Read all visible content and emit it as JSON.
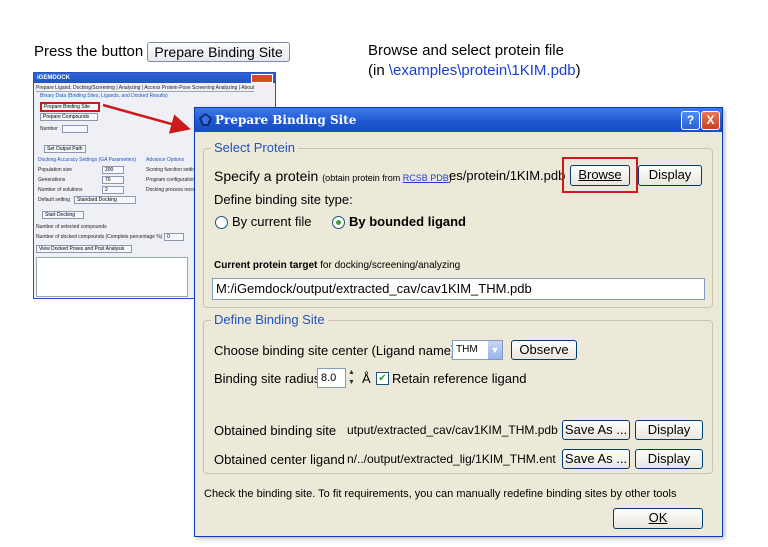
{
  "captions": {
    "press_prefix": "Press the button",
    "press_button": "Prepare Binding Site",
    "browse_line1": "Browse and select protein file",
    "browse_line2_prefix": "(in ",
    "browse_path": "\\examples\\protein\\1KIM.pdb",
    "browse_line2_suffix": ")"
  },
  "thumbnail": {
    "title": "iGEMDOCK",
    "tabs": "Prepare Ligand, Docking/Screening  | Analyzing | Access Protein-Pose Screening Analyzing | About",
    "group_caption": "Binary Data (Binding Sites, Ligands, and Docked Results)",
    "prepare_binding_site": "Prepare Binding Site",
    "prepare_compounds": "Prepare Compounds",
    "number_label": "Number",
    "set_output_path": "Set Output Path",
    "ga_caption": "Docking Accuracy Settings (GA Parameters)",
    "advanced_caption": "Advance Options",
    "rows": [
      {
        "label": "Population size",
        "value": "200"
      },
      {
        "label": "Generations",
        "value": "70"
      },
      {
        "label": "Number of solutions",
        "value": "2"
      }
    ],
    "scoring_label": "Scoring function setting",
    "program_config": "Program configuration",
    "docking_process": "Docking process recor",
    "default_setting_label": "Default setting",
    "default_setting_value": "Standard Docking",
    "start_docking": "Start Docking",
    "selected_compounds": "Number of selected compounds",
    "docked_compounds": "Number of docked compounds (Complete percentage %)",
    "docked_value": "0",
    "view_docked": "View Docked Poses and Post Analysis"
  },
  "dialog": {
    "title": "Prepare Binding Site",
    "help": "?",
    "close": "X",
    "select_protein": {
      "legend": "Select Protein",
      "specify_label": "Specify a protein",
      "specify_hint": "(obtain protein from",
      "rcsb_link": "RCSB PDB",
      "specify_hint_end": ")",
      "path_value": "es/protein/1KIM.pdb",
      "browse": "Browse",
      "display": "Display",
      "define_type": "Define binding site type:",
      "by_current_file": "By current file",
      "by_bounded_ligand": "By bounded ligand",
      "current_target_bold": "Current protein target",
      "current_target_rest": " for docking/screening/analyzing",
      "target_path": "M:/iGemdock/output/extracted_cav/cav1KIM_THM.pdb"
    },
    "define_binding_site": {
      "legend": "Define Binding Site",
      "choose_center_label": "Choose binding site center (Ligand name)",
      "ligand_name": "THM",
      "observe": "Observe",
      "radius_label": "Binding site radius",
      "radius_value": "8.0",
      "radius_unit": "Å",
      "retain_label": "Retain reference ligand",
      "obtained_site_label": "Obtained binding site",
      "obtained_site_value": "utput/extracted_cav/cav1KIM_THM.pdb",
      "obtained_center_label": "Obtained center ligand",
      "obtained_center_value": "n/../output/extracted_lig/1KIM_THM.ent",
      "save_as": "Save As ...",
      "display": "Display"
    },
    "footer_text": "Check the binding site. To fit requirements, you can manually redefine binding sites by other tools",
    "ok": "OK"
  },
  "colors": {
    "highlight_red": "#cc1a1a",
    "caption_blue": "#1a3fd6",
    "title_bar_blue": "#1c55cf",
    "legend_blue": "#2251c5"
  }
}
